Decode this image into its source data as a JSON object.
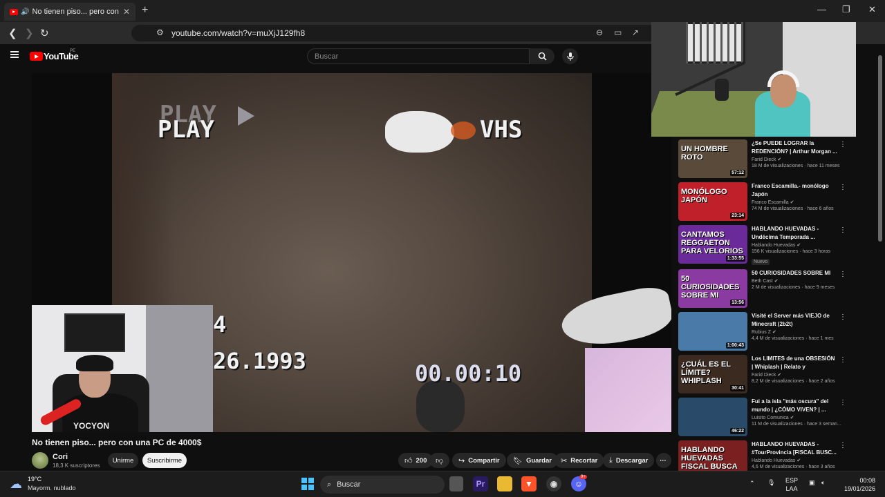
{
  "browser": {
    "tab_title": "No tienen piso... pero con un",
    "url": "youtube.com/watch?v=muXjJ129fh8"
  },
  "youtube": {
    "logo_text": "YouTube",
    "logo_region": "PE",
    "search_placeholder": "Buscar"
  },
  "video": {
    "overlay_play_ghost": "PLAY",
    "overlay_play": "PLAY",
    "overlay_vhs": "VHS",
    "overlay_digit": "4",
    "overlay_date": "26.1993",
    "overlay_counter": "00.00:10",
    "cam_shirt_text": "YOCYON"
  },
  "info": {
    "title": "No tienen piso... pero con una PC de 4000$",
    "channel": "Cori",
    "subscribers": "18,3 K suscriptores",
    "join_label": "Unirme",
    "subscribe_label": "Suscribirme",
    "likes": "200",
    "share_label": "Compartir",
    "save_label": "Guardar",
    "clip_label": "Recortar",
    "download_label": "Descargar"
  },
  "recommendations": [
    {
      "title": "¿Se PUEDE LOGRAR la REDENCIÓN? | Arthur Morgan ...",
      "channel": "Farid Dieck",
      "meta": "18 M de visualizaciones · hace 11 meses",
      "duration": "57:12",
      "thumb_text": "UN HOMBRE ROTO",
      "thumb_color": "#5a4a3a"
    },
    {
      "title": "Franco Escamilla.- monólogo Japón",
      "channel": "Franco Escamilla",
      "meta": "74 M de visualizaciones · hace 6 años",
      "duration": "23:14",
      "thumb_text": "MONÓLOGO JAPÓN",
      "thumb_color": "#c0202a"
    },
    {
      "title": "HABLANDO HUEVADAS - Undécima Temporada ...",
      "channel": "Hablando Huevadas",
      "meta": "156 K visualizaciones · hace 3 horas",
      "duration": "1:33:55",
      "thumb_text": "CANTAMOS REGGAETON PARA VELORIOS",
      "thumb_color": "#6a2a9a",
      "badge": "Nuevo"
    },
    {
      "title": "50 CURIOSIDADES SOBRE MI",
      "channel": "Beth Cast",
      "meta": "2 M de visualizaciones · hace 9 meses",
      "duration": "13:56",
      "thumb_text": "50 CURIOSIDADES SOBRE MI",
      "thumb_color": "#8a3aa0"
    },
    {
      "title": "Visité el Server más VIEJO de Minecraft (2b2t)",
      "channel": "Rubius Z",
      "meta": "4,4 M de visualizaciones · hace 1 mes",
      "duration": "1:00:43",
      "thumb_text": "",
      "thumb_color": "#4a7aa8"
    },
    {
      "title": "Los LIMITES de una OBSESIÓN | Whiplash | Relato y Reflexiones",
      "channel": "Farid Dieck",
      "meta": "8,2 M de visualizaciones · hace 2 años",
      "duration": "30:41",
      "thumb_text": "¿CUÁL ES EL LÍMITE? WHIPLASH",
      "thumb_color": "#3a2a20"
    },
    {
      "title": "Fui a la isla \"más oscura\" del mundo | ¿CÓMO VIVEN? | ...",
      "channel": "Luisito Comunica",
      "meta": "11 M de visualizaciones · hace 3 seman...",
      "duration": "46:22",
      "thumb_text": "",
      "thumb_color": "#2a4a6a"
    },
    {
      "title": "HABLANDO HUEVADAS - #TourProvincia [FISCAL BUSC...",
      "channel": "Hablando Huevadas",
      "meta": "4,6 M de visualizaciones · hace 3 años",
      "duration": "",
      "thumb_text": "HABLANDO HUEVADAS FISCAL BUSCA",
      "thumb_color": "#7a2020"
    }
  ],
  "taskbar": {
    "temperature": "19°C",
    "condition": "Mayorm. nublado",
    "search_label": "Buscar",
    "lang": "ESP",
    "layout": "LAA",
    "time": "00:08",
    "date": "19/01/2026",
    "discord_badge": "9+"
  },
  "colors": {
    "accent_red": "#ff0000",
    "background": "#0f0f0f",
    "button_dark": "#272727"
  }
}
